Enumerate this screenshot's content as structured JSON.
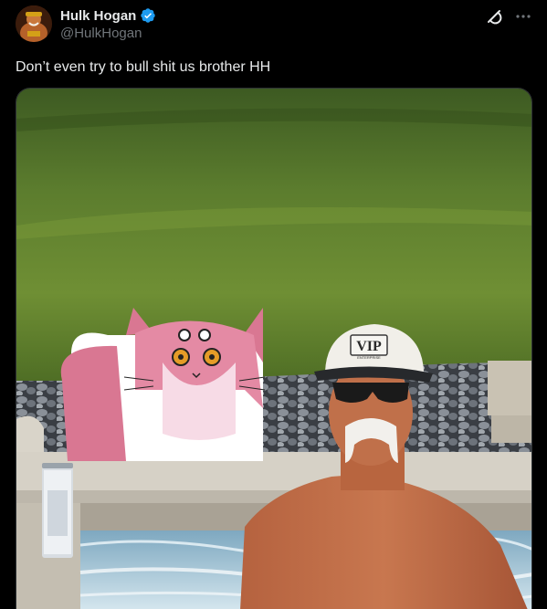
{
  "author": {
    "display_name": "Hulk Hogan",
    "handle": "@HulkHogan",
    "verified": true,
    "verified_color": "#1d9bf0",
    "avatar_icon": "profile-photo"
  },
  "actions": {
    "grok_icon": "grok-icon",
    "more_icon": "more-options-icon"
  },
  "tweet": {
    "text": "Don’t even try to bull shit us brother HH"
  },
  "media": {
    "cap_text": "VIP",
    "cap_subtext": "ENTERPRISE"
  }
}
